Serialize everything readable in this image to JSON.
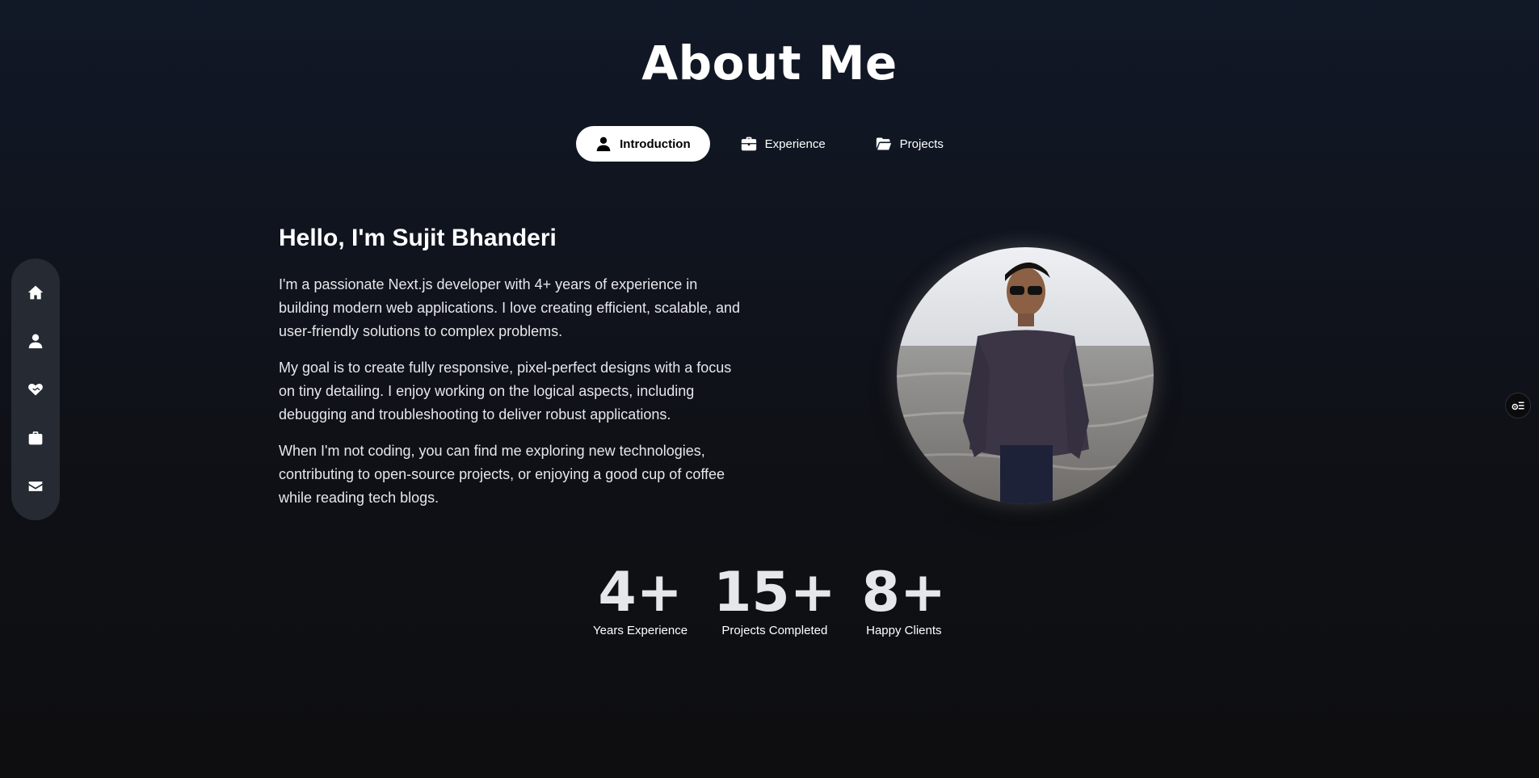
{
  "page": {
    "title": "About Me"
  },
  "tabs": [
    {
      "label": "Introduction",
      "icon": "user-icon",
      "active": true
    },
    {
      "label": "Experience",
      "icon": "briefcase-icon",
      "active": false
    },
    {
      "label": "Projects",
      "icon": "folder-open-icon",
      "active": false
    }
  ],
  "sidebar": {
    "items": [
      {
        "icon": "home-icon"
      },
      {
        "icon": "user-icon"
      },
      {
        "icon": "heart-handshake-icon"
      },
      {
        "icon": "briefcase-icon"
      },
      {
        "icon": "envelope-icon"
      }
    ]
  },
  "intro": {
    "greeting": "Hello, I'm Sujit Bhanderi",
    "paragraphs": [
      "I'm a passionate Next.js developer with 4+ years of experience in building modern web applications. I love creating efficient, scalable, and user-friendly solutions to complex problems.",
      "My goal is to create fully responsive, pixel-perfect designs with a focus on tiny detailing. I enjoy working on the logical aspects, including debugging and troubleshooting to deliver robust applications.",
      "When I'm not coding, you can find me exploring new technologies, contributing to open-source projects, or enjoying a good cup of coffee while reading tech blogs."
    ]
  },
  "stats": [
    {
      "value": "4+",
      "label": "Years Experience"
    },
    {
      "value": "15+",
      "label": "Projects Completed"
    },
    {
      "value": "8+",
      "label": "Happy Clients"
    }
  ],
  "floating": {
    "icon": "settings-list-icon"
  },
  "colors": {
    "background_top": "#111827",
    "background_bottom": "#0e0e10",
    "sidebar": "#252a33",
    "active_tab": "#ffffff"
  }
}
